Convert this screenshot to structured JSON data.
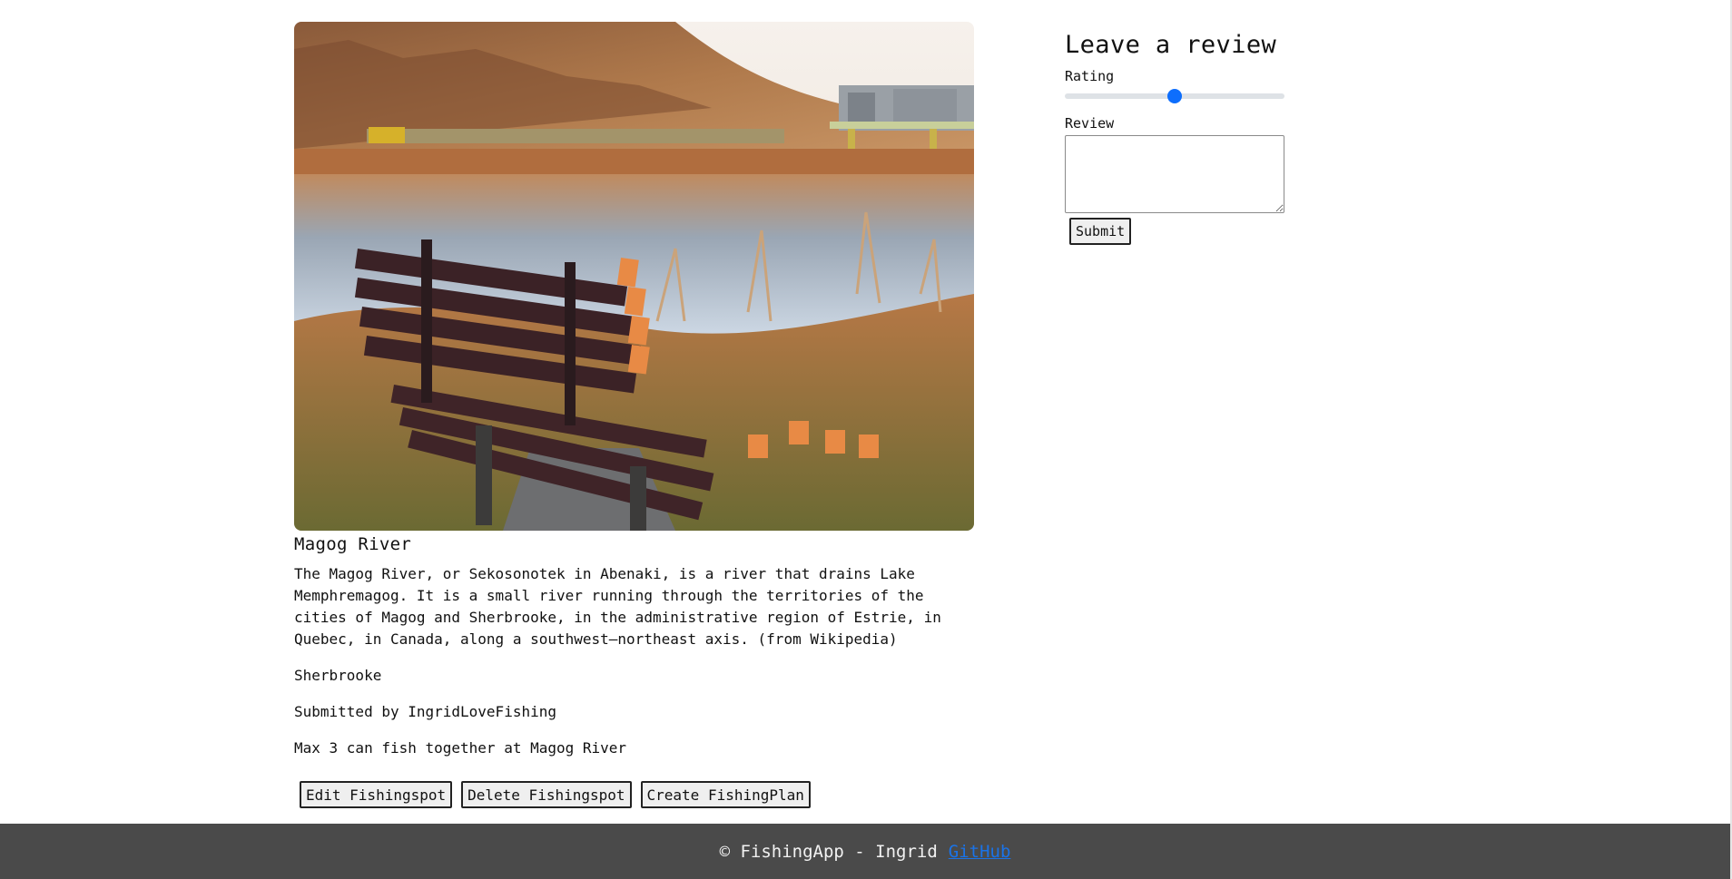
{
  "spot": {
    "image_alt": "Wooden park bench overlooking the Magog River at sunset with a train crossing in the distance",
    "title": "Magog River",
    "description": "The Magog River, or Sekosonotek in Abenaki, is a river that drains Lake Memphremagog. It is a small river running through the territories of the cities of Magog and Sherbrooke, in the administrative region of Estrie, in Quebec, in Canada, along a southwest–northeast axis. (from Wikipedia)",
    "city": "Sherbrooke",
    "submitted_by": "Submitted by IngridLoveFishing",
    "capacity": "Max 3 can fish together at Magog River"
  },
  "actions": {
    "edit_label": "Edit Fishingspot",
    "delete_label": "Delete Fishingspot",
    "create_plan_label": "Create FishingPlan"
  },
  "review": {
    "heading": "Leave a review",
    "rating_label": "Rating",
    "rating_value": 3,
    "rating_min": 1,
    "rating_max": 5,
    "review_label": "Review",
    "review_value": "",
    "submit_label": "Submit"
  },
  "footer": {
    "text": "© FishingApp - Ingrid",
    "link_label": "GitHub"
  },
  "colors": {
    "accent": "#0d6efd",
    "footer_bg": "#4a4a4a",
    "link": "#1a73e8"
  }
}
